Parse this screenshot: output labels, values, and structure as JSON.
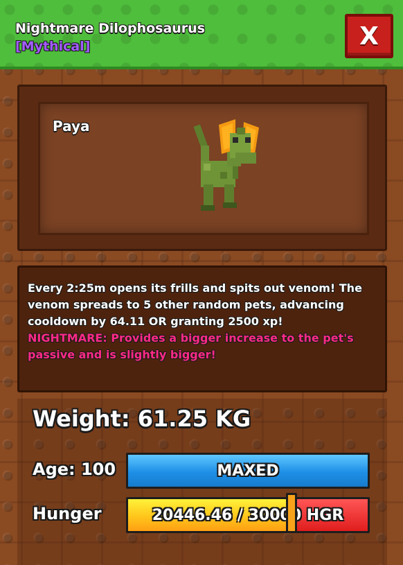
{
  "header": {
    "pet_name": "Nightmare Dilophosaurus",
    "rarity": "[Mythical]",
    "close_label": "X"
  },
  "pet": {
    "owner": "Paya"
  },
  "description": {
    "ability_text": "Every 2:25m opens its frills and spits out venom! The venom spreads to 5 other random pets, advancing cooldown by 64.11 OR granting 2500 xp!",
    "nightmare_text": "NIGHTMARE: Provides a bigger increase to the pet's passive and is slightly bigger!"
  },
  "stats": {
    "weight_label": "Weight: 61.25 KG",
    "age_label": "Age: 100",
    "age_bar_text": "MAXED",
    "hunger_label": "Hunger",
    "hunger_bar_text": "20446.46 / 30000 HGR",
    "hunger_current": 20446.46,
    "hunger_max": 30000
  },
  "colors": {
    "header_green": "#4fbe3c",
    "close_red": "#c8201c",
    "rarity_purple": "#a35cff",
    "nightmare_pink": "#ff2a86",
    "age_bar_blue": "#1e8fe6",
    "hunger_yellow": "#ffc51a",
    "hunger_red": "#e01d1d"
  }
}
